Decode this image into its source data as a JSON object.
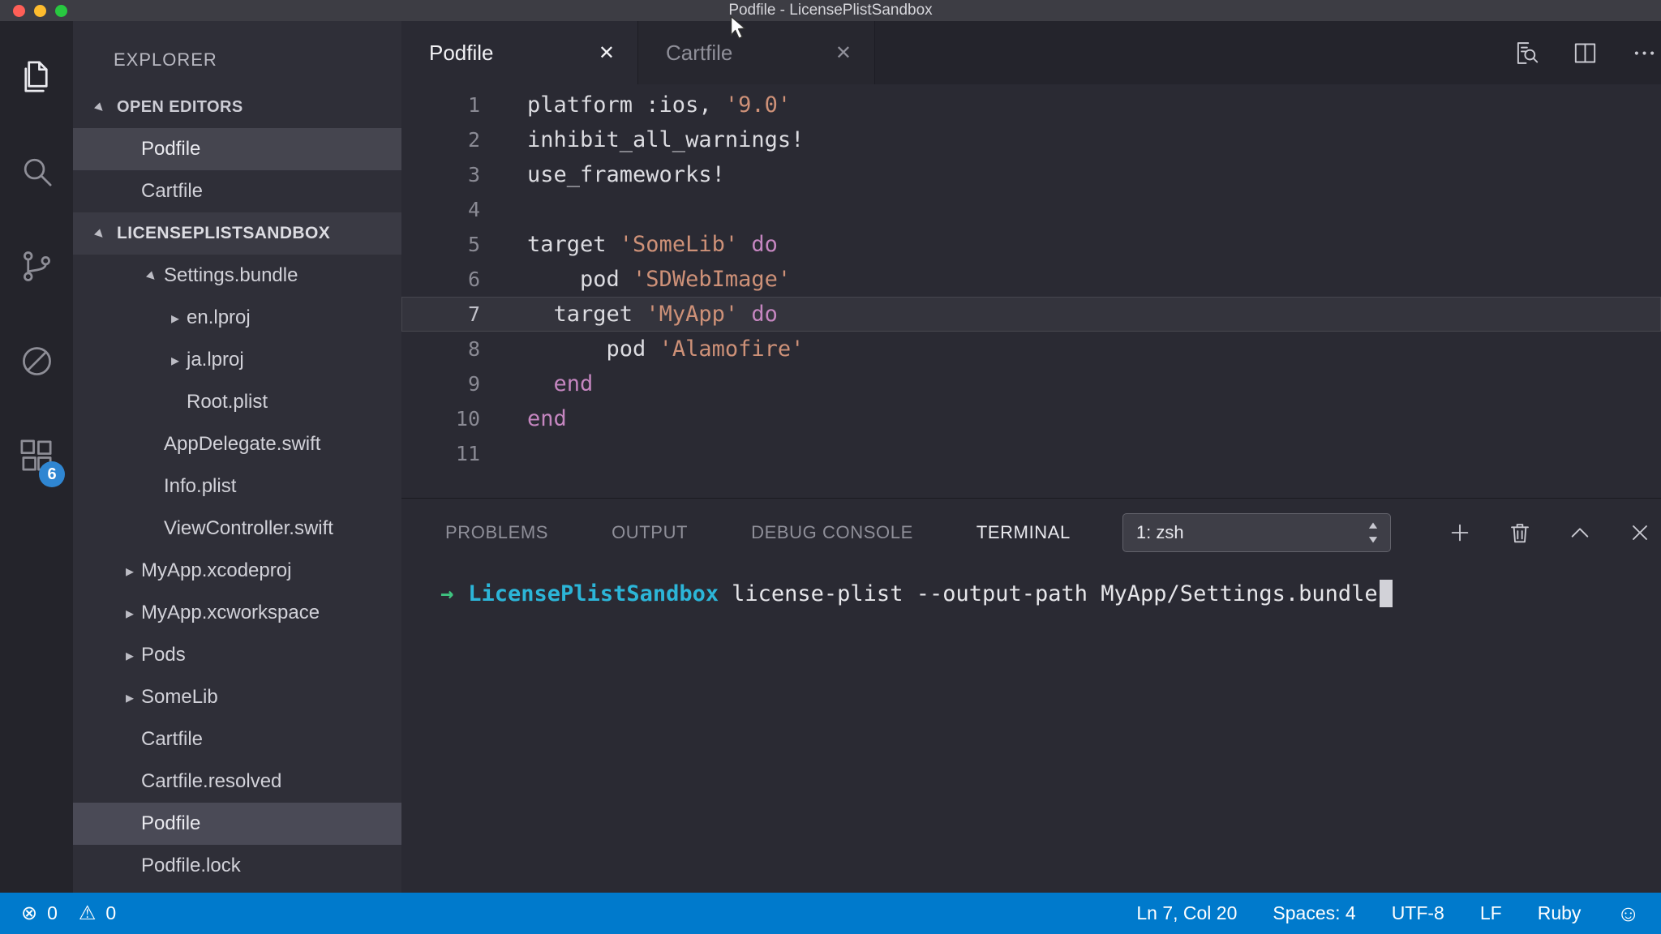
{
  "titlebar": {
    "title": "Podfile - LicensePlistSandbox"
  },
  "activity_bar": {
    "items": [
      {
        "icon": "files-icon",
        "active": true
      },
      {
        "icon": "search-icon",
        "active": false
      },
      {
        "icon": "source-control-icon",
        "active": false
      },
      {
        "icon": "debug-icon",
        "active": false
      },
      {
        "icon": "extensions-icon",
        "active": false,
        "badge": "6"
      }
    ]
  },
  "sidebar": {
    "title": "EXPLORER",
    "open_editors": {
      "label": "OPEN EDITORS",
      "items": [
        {
          "label": "Podfile",
          "selected": true
        },
        {
          "label": "Cartfile",
          "selected": false
        }
      ]
    },
    "project": {
      "label": "LICENSEPLISTSANDBOX",
      "items": [
        {
          "label": "Settings.bundle",
          "indent": 1,
          "arrow": "expanded",
          "selected": false
        },
        {
          "label": "en.lproj",
          "indent": 2,
          "arrow": "collapsed",
          "selected": false
        },
        {
          "label": "ja.lproj",
          "indent": 2,
          "arrow": "collapsed",
          "selected": false
        },
        {
          "label": "Root.plist",
          "indent": 2,
          "arrow": "none",
          "selected": false
        },
        {
          "label": "AppDelegate.swift",
          "indent": 1,
          "arrow": "none",
          "selected": false
        },
        {
          "label": "Info.plist",
          "indent": 1,
          "arrow": "none",
          "selected": false
        },
        {
          "label": "ViewController.swift",
          "indent": 1,
          "arrow": "none",
          "selected": false
        },
        {
          "label": "MyApp.xcodeproj",
          "indent": 0,
          "arrow": "collapsed",
          "selected": false
        },
        {
          "label": "MyApp.xcworkspace",
          "indent": 0,
          "arrow": "collapsed",
          "selected": false
        },
        {
          "label": "Pods",
          "indent": 0,
          "arrow": "collapsed",
          "selected": false
        },
        {
          "label": "SomeLib",
          "indent": 0,
          "arrow": "collapsed",
          "selected": false
        },
        {
          "label": "Cartfile",
          "indent": 0,
          "arrow": "none",
          "selected": false
        },
        {
          "label": "Cartfile.resolved",
          "indent": 0,
          "arrow": "none",
          "selected": false
        },
        {
          "label": "Podfile",
          "indent": 0,
          "arrow": "none",
          "selected": true
        },
        {
          "label": "Podfile.lock",
          "indent": 0,
          "arrow": "none",
          "selected": false
        }
      ]
    }
  },
  "editor": {
    "tabs": [
      {
        "label": "Podfile",
        "active": true
      },
      {
        "label": "Cartfile",
        "active": false
      }
    ],
    "actions": [
      "search-editor-icon",
      "split-editor-icon",
      "ellipsis-icon"
    ],
    "lines": [
      {
        "num": 1,
        "current": false,
        "tokens": [
          [
            "platform :ios, ",
            "fg"
          ],
          [
            "'9.0'",
            "str"
          ]
        ]
      },
      {
        "num": 2,
        "current": false,
        "tokens": [
          [
            "inhibit_all_warnings!",
            "fg"
          ]
        ]
      },
      {
        "num": 3,
        "current": false,
        "tokens": [
          [
            "use_frameworks!",
            "fg"
          ]
        ]
      },
      {
        "num": 4,
        "current": false,
        "tokens": []
      },
      {
        "num": 5,
        "current": false,
        "tokens": [
          [
            "target ",
            "fg"
          ],
          [
            "'SomeLib'",
            "str"
          ],
          [
            " do",
            "kw"
          ]
        ]
      },
      {
        "num": 6,
        "current": false,
        "tokens": [
          [
            "    pod ",
            "fg"
          ],
          [
            "'SDWebImage'",
            "str"
          ]
        ]
      },
      {
        "num": 7,
        "current": true,
        "tokens": [
          [
            "  target ",
            "fg"
          ],
          [
            "'MyApp'",
            "str"
          ],
          [
            " do",
            "kw"
          ]
        ]
      },
      {
        "num": 8,
        "current": false,
        "tokens": [
          [
            "      pod ",
            "fg"
          ],
          [
            "'Alamofire'",
            "str"
          ]
        ]
      },
      {
        "num": 9,
        "current": false,
        "tokens": [
          [
            "  end",
            "kw"
          ]
        ]
      },
      {
        "num": 10,
        "current": false,
        "tokens": [
          [
            "end",
            "kw"
          ]
        ]
      },
      {
        "num": 11,
        "current": false,
        "tokens": []
      }
    ]
  },
  "panel": {
    "tabs": [
      {
        "label": "PROBLEMS",
        "active": false
      },
      {
        "label": "OUTPUT",
        "active": false
      },
      {
        "label": "DEBUG CONSOLE",
        "active": false
      },
      {
        "label": "TERMINAL",
        "active": true
      }
    ],
    "shell_select": "1: zsh",
    "actions": [
      "plus-icon",
      "trash-icon",
      "chevron-up-icon",
      "close-icon"
    ],
    "terminal": {
      "prompt": "→",
      "directory": "LicensePlistSandbox",
      "command": "license-plist --output-path MyApp/Settings.bundle"
    }
  },
  "statusbar": {
    "errors": "0",
    "warnings": "0",
    "right": [
      "Ln 7, Col 20",
      "Spaces: 4",
      "UTF-8",
      "LF",
      "Ruby"
    ]
  },
  "colors": {
    "accent": "#007acc",
    "badge": "#2f86d2",
    "string": "#ce9178",
    "keyword": "#c586c0",
    "terminal_dir": "#2cb5d8",
    "terminal_prompt": "#3fc380"
  }
}
